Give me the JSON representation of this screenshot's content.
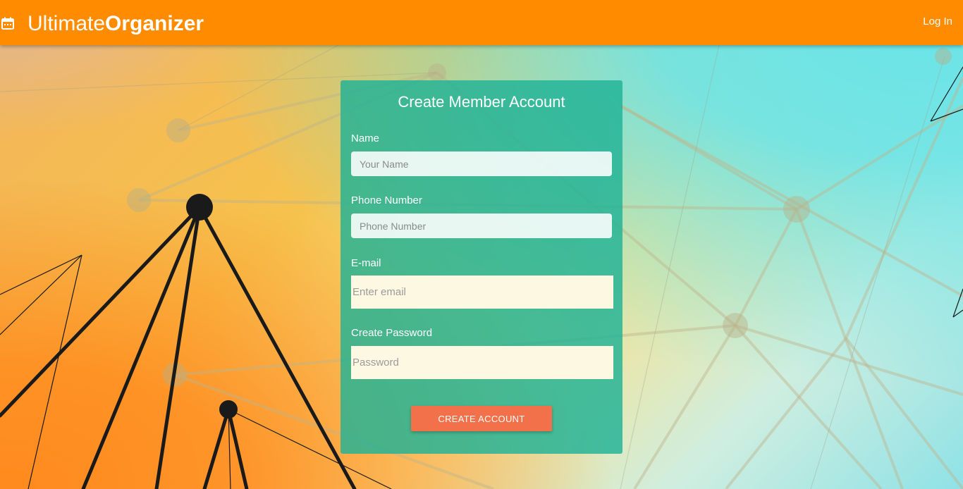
{
  "header": {
    "brand_light": "Ultimate",
    "brand_bold": "Organizer",
    "brand_icon": "calendar-icon",
    "login_label": "Log In",
    "color": "#ff8c00"
  },
  "form": {
    "title": "Create Member Account",
    "name_label": "Name",
    "name_placeholder": "Your Name",
    "phone_label": "Phone Number",
    "phone_placeholder": "Phone Number",
    "email_label": "E-mail",
    "email_placeholder": "Enter email",
    "password_label": "Create Password",
    "password_placeholder": "Password",
    "submit_label": "CREATE ACCOUNT",
    "card_color": "#20b296",
    "button_color": "#f2704a"
  }
}
